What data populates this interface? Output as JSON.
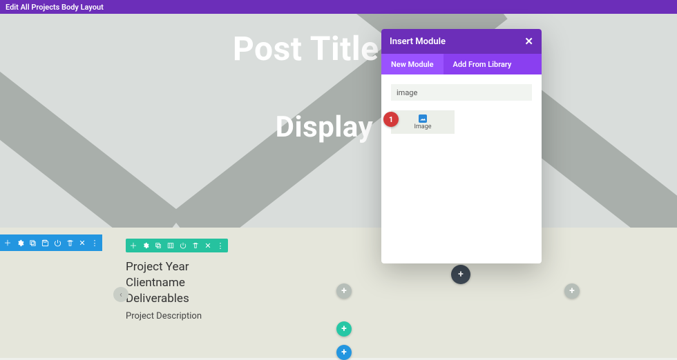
{
  "topbar": {
    "title": "Edit All Projects Body Layout"
  },
  "hero": {
    "title": "Post Title Will",
    "subtitle": "Display H"
  },
  "section_toolbar": {
    "icons": [
      "add",
      "gear",
      "duplicate",
      "save",
      "power",
      "trash",
      "close",
      "more"
    ]
  },
  "row_toolbar": {
    "icons": [
      "add",
      "gear",
      "duplicate",
      "columns",
      "power",
      "trash",
      "close",
      "more"
    ]
  },
  "project_block": {
    "line1": "Project Year",
    "line2": "Clientname",
    "line3": "Deliverables",
    "description": "Project Description"
  },
  "add_buttons": {
    "gray1": "+",
    "gray2": "+",
    "green": "+",
    "blue": "+",
    "dark": "+"
  },
  "arrow_btn": "‹",
  "modal": {
    "title": "Insert Module",
    "tabs": {
      "new": "New Module",
      "library": "Add From Library"
    },
    "search_value": "image",
    "option_label": "Image"
  },
  "badge": {
    "num": "1"
  },
  "colors": {
    "purple": "#6c2eb9",
    "purple_light": "#8a3ff0",
    "blue": "#2396e0",
    "green": "#26c29f",
    "red": "#d43a3a"
  }
}
